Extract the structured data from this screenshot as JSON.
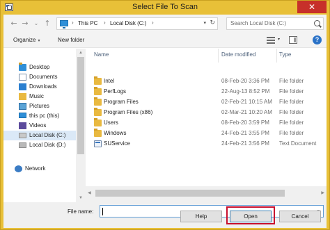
{
  "window": {
    "title": "Select File To Scan",
    "close_glyph": "✕"
  },
  "address": {
    "back": "←",
    "forward": "→",
    "recent": "⌄",
    "up": "↑",
    "crumbs": [
      "This PC",
      "Local Disk (C:)"
    ],
    "sep": "›",
    "dropdown": "▾",
    "refresh": "↻"
  },
  "search": {
    "placeholder": "Search Local Disk (C:)"
  },
  "toolbar": {
    "organize": "Organize",
    "organize_caret": "▾",
    "new_folder": "New folder",
    "view_caret": "▾",
    "help": "?"
  },
  "nav": {
    "items": [
      {
        "label": "Desktop"
      },
      {
        "label": "Documents"
      },
      {
        "label": "Downloads"
      },
      {
        "label": "Music"
      },
      {
        "label": "Pictures"
      },
      {
        "label": "this pc (this)"
      },
      {
        "label": "Videos"
      },
      {
        "label": "Local Disk (C:)",
        "selected": true
      },
      {
        "label": "Local Disk (D:)"
      },
      {
        "label": "Network"
      }
    ]
  },
  "columns": {
    "name": "Name",
    "date": "Date modified",
    "type": "Type"
  },
  "files": [
    {
      "name": "Intel",
      "date": "08-Feb-20 3:36 PM",
      "type": "File folder",
      "icon": "folder-icon"
    },
    {
      "name": "PerfLogs",
      "date": "22-Aug-13 8:52 PM",
      "type": "File folder",
      "icon": "folder-icon"
    },
    {
      "name": "Program Files",
      "date": "02-Feb-21 10:15 AM",
      "type": "File folder",
      "icon": "folder-icon"
    },
    {
      "name": "Program Files (x86)",
      "date": "02-Mar-21 10:20 AM",
      "type": "File folder",
      "icon": "folder-icon"
    },
    {
      "name": "Users",
      "date": "08-Feb-20 3:59 PM",
      "type": "File folder",
      "icon": "folder-icon"
    },
    {
      "name": "Windows",
      "date": "24-Feb-21 3:55 PM",
      "type": "File folder",
      "icon": "folder-icon"
    },
    {
      "name": "SUService",
      "date": "24-Feb-21 3:56 PM",
      "type": "Text Document",
      "icon": "document-icon"
    }
  ],
  "bottom": {
    "file_name_label": "File name:",
    "file_name_value": "",
    "filename_dropdown": "▾",
    "help_button": "Help",
    "open_button": "Open",
    "cancel_button": "Cancel"
  },
  "scroll": {
    "up": "▲",
    "down": "▼",
    "left": "◀",
    "right": "▶"
  },
  "colors": {
    "title_bar": "#e8c038",
    "close": "#c7302a",
    "highlight": "#c8102e",
    "selected": "#dbe9f7"
  }
}
